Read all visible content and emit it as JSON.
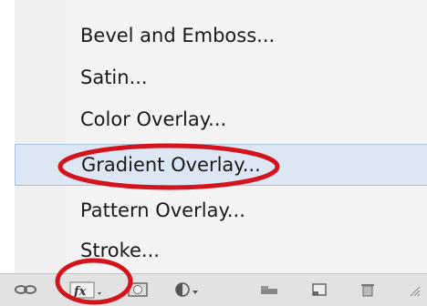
{
  "menu": {
    "items": [
      {
        "label": "Bevel and Emboss..."
      },
      {
        "label": "Satin..."
      },
      {
        "label": "Color Overlay..."
      },
      {
        "label": "Gradient Overlay..."
      },
      {
        "label": "Pattern Overlay..."
      },
      {
        "label": "Stroke..."
      }
    ],
    "highlighted_item": "Gradient Overlay..."
  },
  "toolbar": {
    "icons": [
      "link-icon",
      "fx-icon",
      "mask-icon",
      "adjustment-icon",
      "group-icon",
      "new-layer-icon",
      "trash-icon"
    ]
  },
  "annotations": {
    "color": "#d4141c",
    "circled": [
      "Gradient Overlay...",
      "fx-icon"
    ]
  }
}
